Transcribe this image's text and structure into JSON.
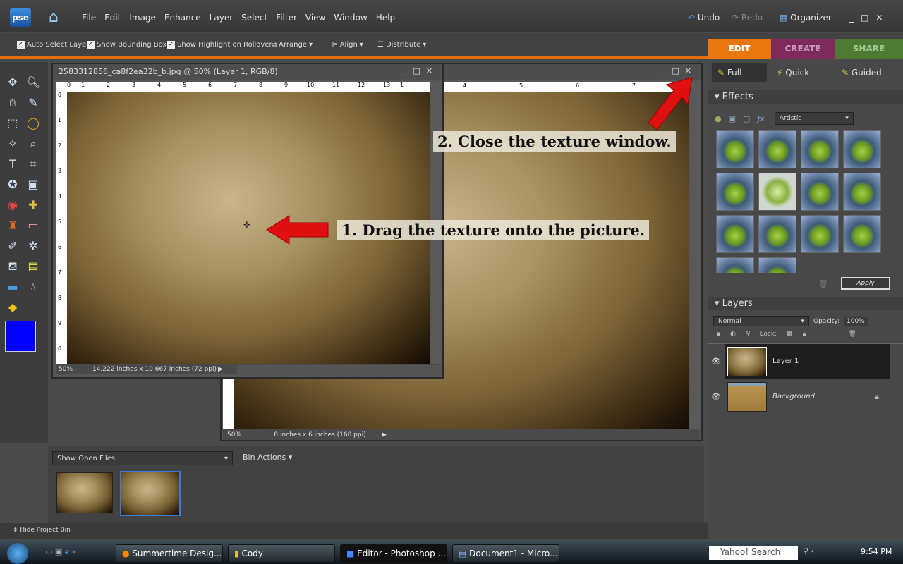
{
  "app": {
    "logo": "pse",
    "menu": [
      "File",
      "Edit",
      "Image",
      "Enhance",
      "Layer",
      "Select",
      "Filter",
      "View",
      "Window",
      "Help"
    ],
    "undo": "Undo",
    "redo": "Redo",
    "organizer": "Organizer"
  },
  "options": {
    "auto_select": "Auto Select Layer",
    "bounding_box": "Show Bounding Box",
    "highlight": "Show Highlight on Rollover",
    "arrange": "Arrange",
    "align": "Align",
    "distribute": "Distribute"
  },
  "mode_tabs": [
    {
      "label": "EDIT",
      "color": "#e8780e"
    },
    {
      "label": "CREATE",
      "color": "#7e2a5a"
    },
    {
      "label": "SHARE",
      "color": "#4f7a34"
    }
  ],
  "edit_modes": [
    "Full",
    "Quick",
    "Guided"
  ],
  "doc1": {
    "title": "2583312856_ca8f2ea32b_b.jpg @ 50% (Layer 1, RGB/8)",
    "zoom": "50%",
    "size": "14.222 inches x 10.667 inches (72 ppi)",
    "ruler": [
      "0",
      "1",
      "2",
      "3",
      "4",
      "5",
      "6",
      "7",
      "8",
      "9",
      "10",
      "11",
      "12",
      "13",
      "1"
    ],
    "vruler": [
      "0",
      "1",
      "2",
      "3",
      "4",
      "5",
      "6",
      "7",
      "8",
      "9",
      "0"
    ]
  },
  "doc2": {
    "zoom": "50%",
    "size": "8 inches x 6 inches (160 ppi)",
    "ruler": [
      "4",
      "5",
      "6",
      "7"
    ]
  },
  "annotations": {
    "step1": "1. Drag the texture onto the picture.",
    "step2": "2. Close the texture window."
  },
  "effects": {
    "title": "Effects",
    "category": "Artistic",
    "apply": "Apply"
  },
  "layers": {
    "title": "Layers",
    "blend": "Normal",
    "opacity_label": "Opacity:",
    "opacity": "100%",
    "lock": "Lock:",
    "items": [
      {
        "name": "Layer 1",
        "selected": true
      },
      {
        "name": "Background",
        "locked": true
      }
    ]
  },
  "bin": {
    "show": "Show Open Files",
    "actions": "Bin Actions",
    "hide": "Hide Project Bin"
  },
  "taskbar": {
    "items": [
      "Summertime Desig...",
      "Cody",
      "Editor - Photoshop ...",
      "Document1 - Micro..."
    ],
    "search": "Yahoo! Search",
    "time": "9:54 PM"
  }
}
